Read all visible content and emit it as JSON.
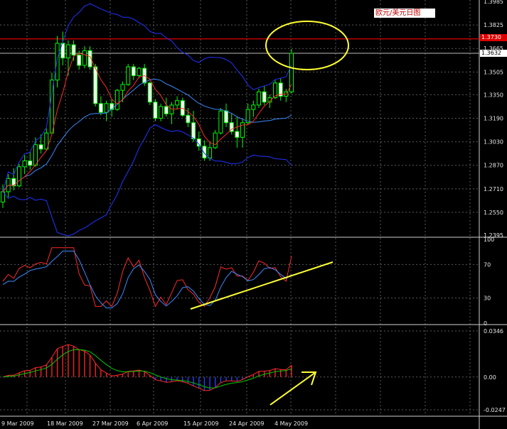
{
  "symbol_label": "欧元/美元日图",
  "price_axis": {
    "ticks": [
      "1.3985",
      "1.3825",
      "1.3665",
      "1.3505",
      "1.3350",
      "1.3190",
      "1.3030",
      "1.2870",
      "1.2710",
      "1.2550",
      "1.2395"
    ],
    "current_price": "1.3632",
    "marked_level": "1.3730"
  },
  "rsi_axis": {
    "ticks": [
      "100",
      "70",
      "30",
      "0"
    ]
  },
  "macd_axis": {
    "ticks": [
      "0.0346",
      "0.00",
      "-0.0247"
    ]
  },
  "date_axis": [
    "9 Mar 2009",
    "18 Mar 2009",
    "27 Mar 2009",
    "6 Apr 2009",
    "15 Apr 2009",
    "24 Apr 2009",
    "4 May 2009"
  ],
  "colors": {
    "background": "#000000",
    "grid": "#5a5a5a",
    "candle_body": "#ffffff",
    "candle_wick": "#00ff00",
    "bollinger": "#2233ff",
    "ma_fast": "#ff2a2a",
    "ma_slow": "#3b8bff",
    "annotation": "#ffff33",
    "macd_pos": "#ff2020",
    "macd_neg": "#2040ff",
    "signal": "#00cc00"
  },
  "chart_data": {
    "type": "candlestick",
    "x_labels": [
      "9 Mar 2009",
      "18 Mar 2009",
      "27 Mar 2009",
      "6 Apr 2009",
      "15 Apr 2009",
      "24 Apr 2009",
      "4 May 2009"
    ],
    "ylim": [
      1.2395,
      1.3985
    ],
    "series": [
      {
        "ohlc": [
          [
            1.262,
            1.274,
            1.258,
            1.269
          ],
          [
            1.269,
            1.281,
            1.265,
            1.278
          ],
          [
            1.278,
            1.285,
            1.27,
            1.273
          ],
          [
            1.273,
            1.288,
            1.272,
            1.286
          ],
          [
            1.286,
            1.294,
            1.281,
            1.29
          ],
          [
            1.29,
            1.296,
            1.284,
            1.287
          ],
          [
            1.287,
            1.306,
            1.286,
            1.301
          ],
          [
            1.301,
            1.308,
            1.295,
            1.298
          ],
          [
            1.298,
            1.312,
            1.297,
            1.309
          ],
          [
            1.309,
            1.35,
            1.308,
            1.345
          ],
          [
            1.345,
            1.375,
            1.34,
            1.37
          ],
          [
            1.37,
            1.378,
            1.355,
            1.36
          ],
          [
            1.36,
            1.372,
            1.348,
            1.369
          ],
          [
            1.369,
            1.372,
            1.358,
            1.362
          ],
          [
            1.362,
            1.365,
            1.352,
            1.355
          ],
          [
            1.355,
            1.368,
            1.353,
            1.365
          ],
          [
            1.365,
            1.368,
            1.352,
            1.354
          ],
          [
            1.354,
            1.356,
            1.327,
            1.329
          ],
          [
            1.329,
            1.334,
            1.321,
            1.323
          ],
          [
            1.323,
            1.331,
            1.317,
            1.329
          ],
          [
            1.329,
            1.332,
            1.32,
            1.325
          ],
          [
            1.325,
            1.339,
            1.324,
            1.338
          ],
          [
            1.338,
            1.344,
            1.33,
            1.342
          ],
          [
            1.342,
            1.356,
            1.341,
            1.354
          ],
          [
            1.354,
            1.356,
            1.345,
            1.348
          ],
          [
            1.348,
            1.354,
            1.347,
            1.353
          ],
          [
            1.353,
            1.356,
            1.341,
            1.343
          ],
          [
            1.343,
            1.344,
            1.328,
            1.33
          ],
          [
            1.33,
            1.332,
            1.317,
            1.319
          ],
          [
            1.319,
            1.329,
            1.317,
            1.327
          ],
          [
            1.327,
            1.333,
            1.32,
            1.322
          ],
          [
            1.322,
            1.33,
            1.315,
            1.328
          ],
          [
            1.328,
            1.334,
            1.325,
            1.331
          ],
          [
            1.331,
            1.333,
            1.32,
            1.321
          ],
          [
            1.321,
            1.326,
            1.313,
            1.316
          ],
          [
            1.316,
            1.324,
            1.303,
            1.305
          ],
          [
            1.305,
            1.31,
            1.297,
            1.3
          ],
          [
            1.3,
            1.304,
            1.29,
            1.292
          ],
          [
            1.292,
            1.303,
            1.29,
            1.299
          ],
          [
            1.299,
            1.311,
            1.298,
            1.309
          ],
          [
            1.309,
            1.326,
            1.308,
            1.324
          ],
          [
            1.324,
            1.329,
            1.313,
            1.316
          ],
          [
            1.316,
            1.322,
            1.308,
            1.31
          ],
          [
            1.31,
            1.32,
            1.299,
            1.306
          ],
          [
            1.306,
            1.318,
            1.299,
            1.316
          ],
          [
            1.316,
            1.329,
            1.315,
            1.325
          ],
          [
            1.325,
            1.331,
            1.32,
            1.328
          ],
          [
            1.328,
            1.339,
            1.326,
            1.337
          ],
          [
            1.337,
            1.341,
            1.328,
            1.33
          ],
          [
            1.33,
            1.335,
            1.326,
            1.333
          ],
          [
            1.333,
            1.345,
            1.332,
            1.343
          ],
          [
            1.343,
            1.346,
            1.331,
            1.334
          ],
          [
            1.334,
            1.339,
            1.33,
            1.337
          ],
          [
            1.337,
            1.366,
            1.336,
            1.3632
          ]
        ]
      }
    ]
  }
}
